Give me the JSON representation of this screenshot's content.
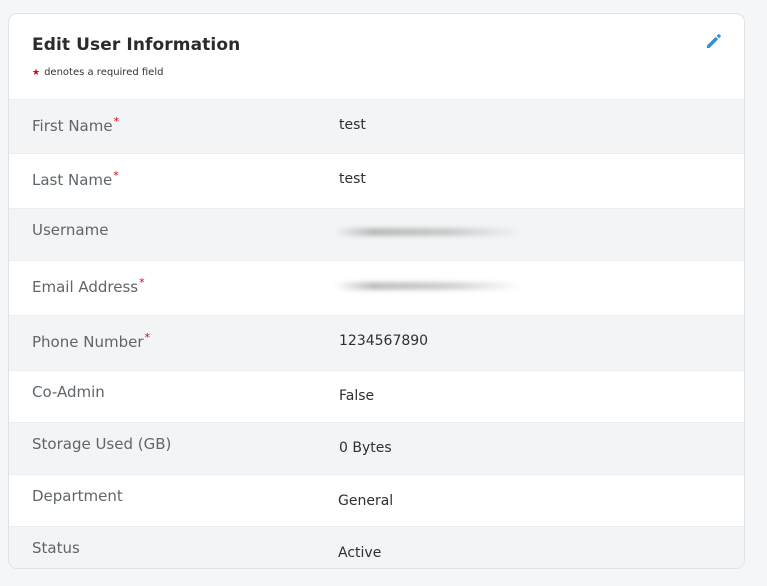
{
  "card": {
    "title": "Edit User Information",
    "required_note": "denotes a required field",
    "required_marker": "*",
    "edit_icon": "pencil-icon"
  },
  "fields": [
    {
      "label": "First Name",
      "required": true,
      "value": "test"
    },
    {
      "label": "Last Name",
      "required": true,
      "value": "test"
    },
    {
      "label": "Username",
      "required": false,
      "value": ""
    },
    {
      "label": "Email Address",
      "required": true,
      "value": ""
    },
    {
      "label": "Phone Number",
      "required": true,
      "value": "1234567890"
    },
    {
      "label": "Co-Admin",
      "required": false,
      "value": "False"
    },
    {
      "label": "Storage Used (GB)",
      "required": false,
      "value": "0 Bytes"
    },
    {
      "label": "Department",
      "required": false,
      "value": "General"
    },
    {
      "label": "Status",
      "required": false,
      "value": "Active"
    }
  ],
  "colors": {
    "accent": "#3a8fd0",
    "required": "#d0021b"
  }
}
